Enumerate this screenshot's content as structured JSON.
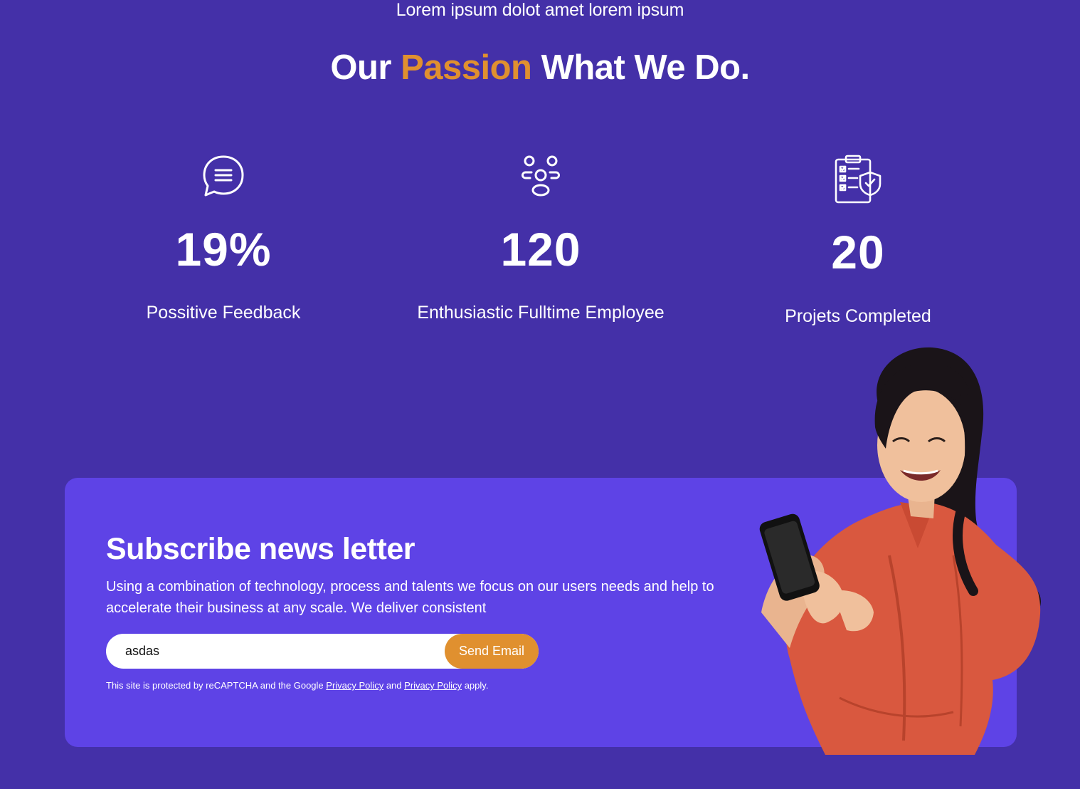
{
  "header": {
    "kicker": "Lorem ipsum dolot amet lorem ipsum",
    "title_prefix": "Our",
    "title_accent": "Passion",
    "title_suffix": "What We Do."
  },
  "stats": [
    {
      "icon": "chat-bubble-icon",
      "value": "19%",
      "label": "Possitive Feedback"
    },
    {
      "icon": "team-icon",
      "value": "120",
      "label": "Enthusiastic Fulltime Employee"
    },
    {
      "icon": "clipboard-checklist-icon",
      "value": "20",
      "label": "Projets Completed"
    }
  ],
  "newsletter": {
    "title": "Subscribe news letter",
    "description": "Using a combination of technology, process and talents we focus on our users needs and help to accelerate their business at any scale. We deliver consistent",
    "email_value": "asdas",
    "send_label": "Send Email",
    "legal_prefix": "This site is protected by reCAPTCHA and the Google",
    "legal_link_1": "Privacy Policy",
    "legal_and": "and",
    "legal_link_2": "Privacy Policy",
    "legal_suffix": "apply."
  },
  "colors": {
    "background": "#4430A8",
    "card": "#5E43E6",
    "accent": "#E0902F"
  }
}
